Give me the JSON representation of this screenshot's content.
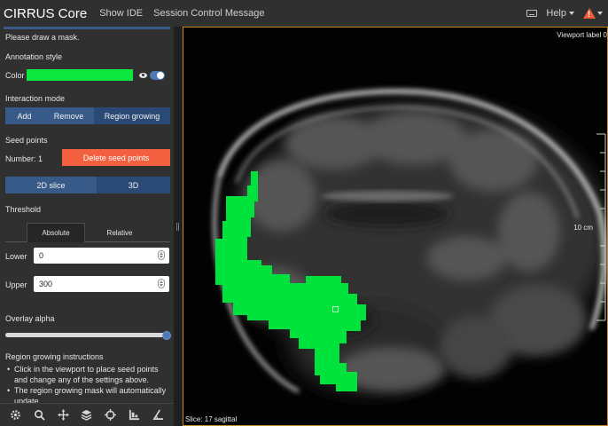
{
  "header": {
    "app_title": "CIRRUS Core",
    "menu": [
      "Show IDE",
      "Session Control Message"
    ],
    "help_label": "Help",
    "warning_badge": "!"
  },
  "sidebar": {
    "prompt": "Please draw a mask.",
    "annotation_style": {
      "heading": "Annotation style",
      "color_label": "Color",
      "color_value": "#0ce63e",
      "visible": true
    },
    "interaction_mode": {
      "heading": "Interaction mode",
      "buttons": [
        "Add",
        "Remove",
        "Region growing"
      ],
      "active": "Region growing"
    },
    "seed_points": {
      "heading": "Seed points",
      "number_text": "Number: 1",
      "delete_label": "Delete seed points"
    },
    "slice_mode": {
      "buttons": [
        "2D slice",
        "3D"
      ],
      "active": "3D"
    },
    "threshold": {
      "heading": "Threshold",
      "tabs": [
        "Absolute",
        "Relative"
      ],
      "active_tab": "Absolute",
      "lower_label": "Lower",
      "lower_value": "0",
      "upper_label": "Upper",
      "upper_value": "300"
    },
    "overlay_alpha": {
      "heading": "Overlay alpha",
      "value": 1.0
    },
    "instructions": {
      "heading": "Region growing instructions",
      "items": [
        "Click in the viewport to place seed points and change any of the settings above.",
        "The region growing mask will automatically update."
      ]
    }
  },
  "toolbar": {
    "tools": [
      "settings-icon",
      "zoom-icon",
      "pan-icon",
      "layers-icon",
      "crosshair-icon",
      "ruler-icon",
      "angle-icon"
    ]
  },
  "viewport": {
    "label": "Viewport label 0",
    "slice_text": "Slice: 17 sagittal",
    "scale_text": "10 cm",
    "mask_color": "#00e33d",
    "border_color": "#c88a2a"
  }
}
